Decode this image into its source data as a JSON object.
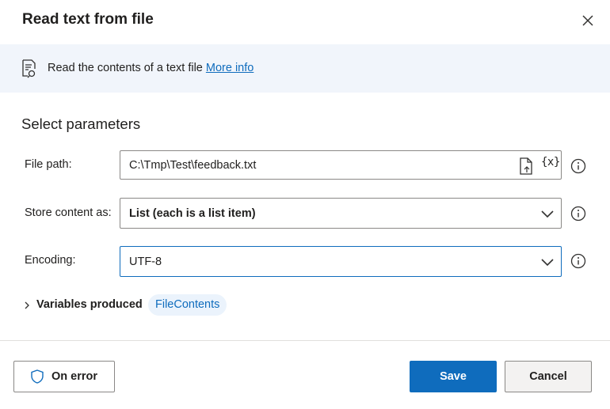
{
  "dialog": {
    "title": "Read text from file",
    "close_icon": "close-icon"
  },
  "banner": {
    "icon": "document-read-icon",
    "text": "Read the contents of a text file",
    "link": "More info"
  },
  "params": {
    "section_title": "Select parameters",
    "file_path": {
      "label": "File path:",
      "value": "C:\\Tmp\\Test\\feedback.txt",
      "var_button": "{x}"
    },
    "store_content": {
      "label": "Store content as:",
      "value": "List (each is a list item)"
    },
    "encoding": {
      "label": "Encoding:",
      "value": "UTF-8"
    }
  },
  "variables": {
    "label": "Variables produced",
    "items": [
      "FileContents"
    ]
  },
  "footer": {
    "on_error": "On error",
    "save": "Save",
    "cancel": "Cancel"
  },
  "colors": {
    "accent": "#0f6cbd",
    "banner_bg": "#f1f5fb",
    "pill_bg": "#ebf3fc"
  }
}
